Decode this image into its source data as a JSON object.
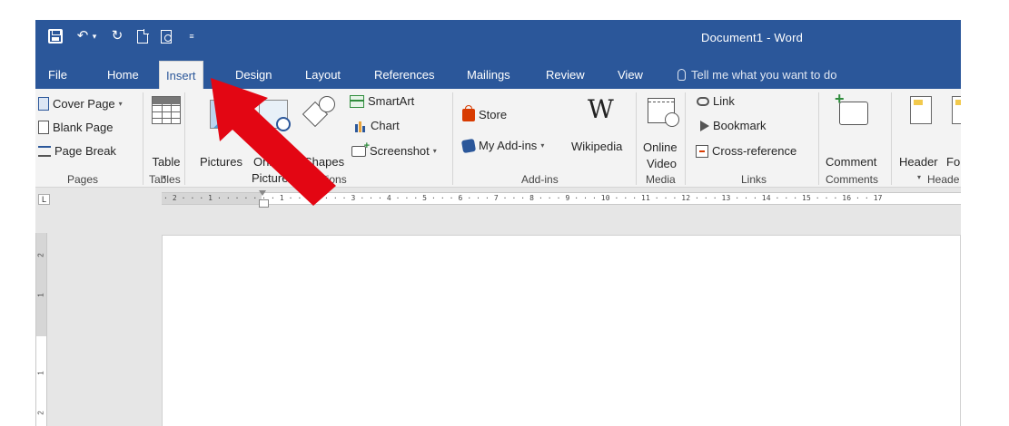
{
  "window": {
    "title": "Document1  -  Word"
  },
  "quick_access": {
    "customize_glyph": "≡"
  },
  "tabs": [
    "File",
    "Home",
    "Insert",
    "Design",
    "Layout",
    "References",
    "Mailings",
    "Review",
    "View"
  ],
  "active_tab": "Insert",
  "tell_me": {
    "placeholder": "Tell me what you want to do"
  },
  "ribbon": {
    "pages": {
      "label": "Pages",
      "cover_page": "Cover Page",
      "blank_page": "Blank Page",
      "page_break": "Page Break"
    },
    "tables": {
      "label": "Tables",
      "table": "Table"
    },
    "illustrations": {
      "label": "Illustrations",
      "pictures": "Pictures",
      "online_pictures_1": "Online",
      "online_pictures_2": "Pictures",
      "shapes": "Shapes",
      "smartart": "SmartArt",
      "chart": "Chart",
      "screenshot": "Screenshot"
    },
    "addins": {
      "label": "Add-ins",
      "store": "Store",
      "my_addins": "My Add-ins",
      "wikipedia": "Wikipedia",
      "wiki_glyph": "W"
    },
    "media": {
      "label": "Media",
      "online_video_1": "Online",
      "online_video_2": "Video"
    },
    "links": {
      "label": "Links",
      "link": "Link",
      "bookmark": "Bookmark",
      "cross_reference": "Cross-reference"
    },
    "comments": {
      "label": "Comments",
      "comment": "Comment"
    },
    "header_footer": {
      "label": "Heade",
      "header": "Header",
      "footer": "Fo"
    }
  },
  "ruler": {
    "corner": "L",
    "text": "· 2 · · · 1 · · · · · · · 1 · · · 2 · · · 3 · · · 4 · · · 5 · · · 6 · · · 7 · · · 8 · · · 9 · · · 10 · · · 11 · · · 12 · · · 13 · · · 14 · · · 15 · · · 16 · · 17"
  },
  "vertical_ruler": {
    "ticks": [
      "2",
      "1",
      "1",
      "2"
    ]
  },
  "colors": {
    "word_blue": "#2b579a",
    "ribbon_bg": "#f3f3f3",
    "annotation_arrow": "#e30613"
  }
}
